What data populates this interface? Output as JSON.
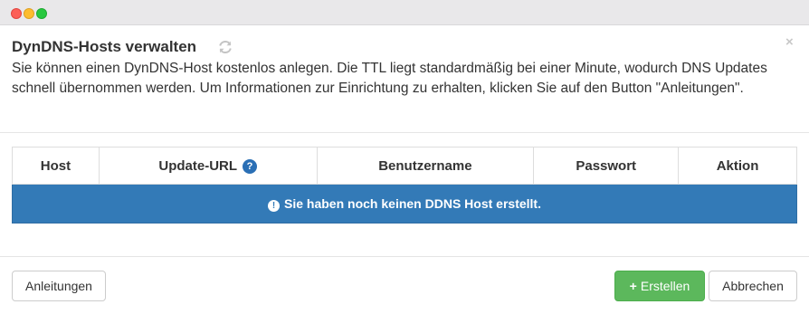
{
  "dialog": {
    "title": "DynDNS-Hosts verwalten",
    "close_label": "×",
    "description": "Sie können einen DynDNS-Host kostenlos anlegen. Die TTL liegt standardmäßig bei einer Minute, wodurch DNS Updates schnell übernommen werden. Um Informationen zur Einrichtung zu erhalten, klicken Sie auf den Button \"Anleitungen\"."
  },
  "table": {
    "columns": [
      "Host",
      "Update-URL",
      "Benutzername",
      "Passwort",
      "Aktion"
    ],
    "help_glyph": "?",
    "empty_message": "Sie haben noch keinen DDNS Host erstellt.",
    "info_glyph": "!"
  },
  "footer": {
    "guides_label": "Anleitungen",
    "create_label": "Erstellen",
    "create_icon": "+",
    "cancel_label": "Abbrechen"
  },
  "icons": {
    "refresh": "refresh-icon",
    "help": "question-circle-icon",
    "info": "exclamation-circle-icon",
    "plus": "plus-icon"
  },
  "colors": {
    "primary": "#337ab7",
    "success": "#5cb85c",
    "help_icon": "#2a6fb5"
  }
}
